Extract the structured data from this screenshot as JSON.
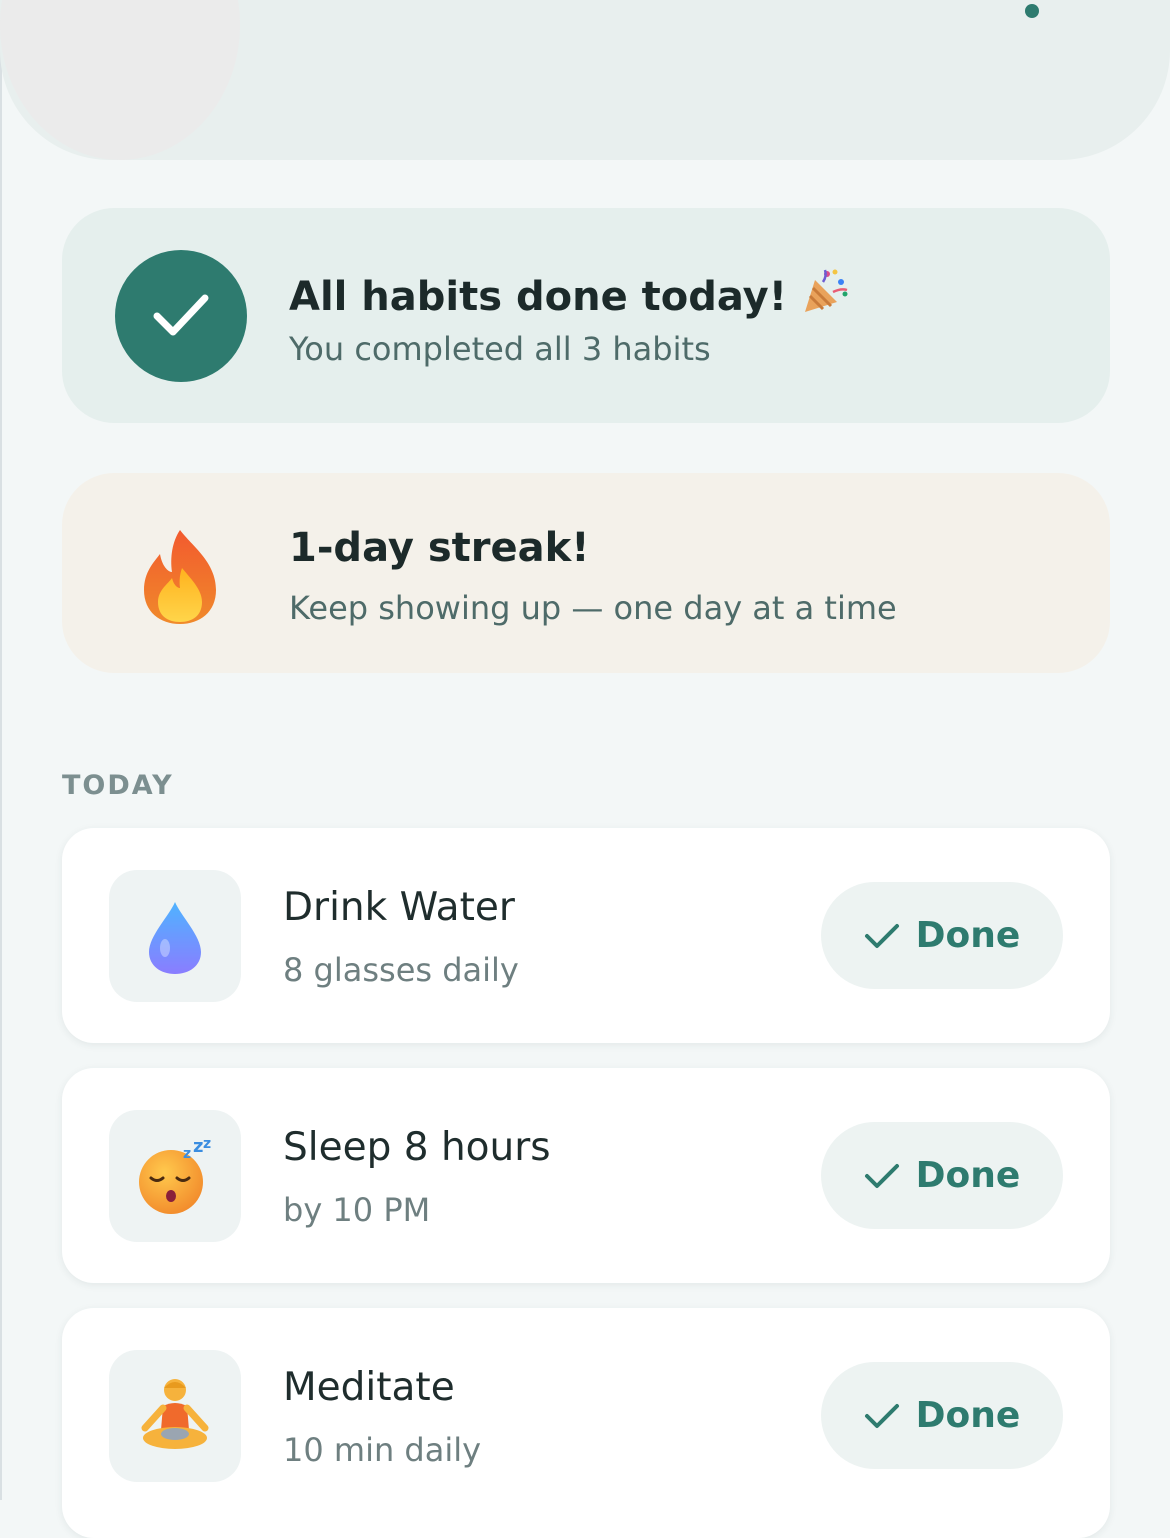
{
  "summary": {
    "title": "All habits done today!",
    "subtitle": "You completed all 3 habits"
  },
  "streak": {
    "title": "1-day streak!",
    "subtitle": "Keep showing up — one day at a time"
  },
  "section": {
    "label": "TODAY"
  },
  "habits": [
    {
      "name": "Drink Water",
      "detail": "8 glasses daily",
      "icon": "water-drop-icon",
      "action": "Done"
    },
    {
      "name": "Sleep 8 hours",
      "detail": "by 10 PM",
      "icon": "sleeping-face-icon",
      "action": "Done"
    },
    {
      "name": "Meditate",
      "detail": "10 min daily",
      "icon": "meditation-icon",
      "action": "Done"
    }
  ],
  "colors": {
    "accent": "#2e7b6f",
    "summary_bg": "#e5efed",
    "streak_bg": "#f4f1ea",
    "page_bg": "#f3f7f7"
  }
}
